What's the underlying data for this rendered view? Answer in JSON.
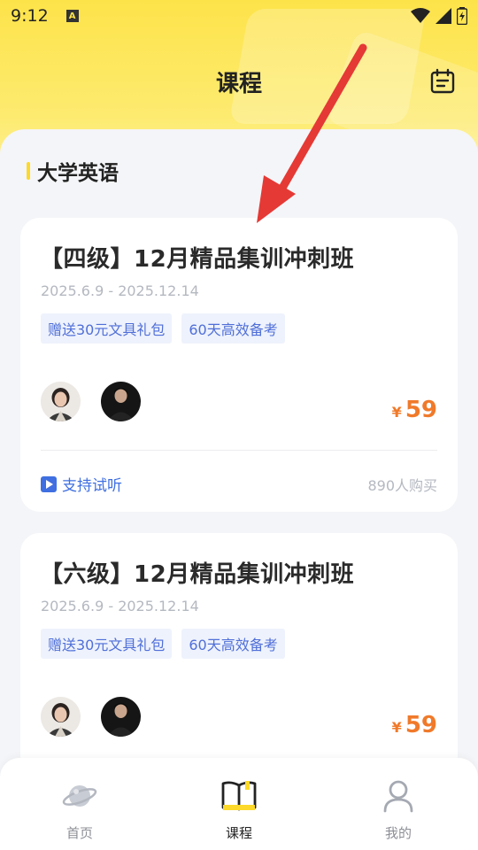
{
  "status_bar": {
    "time": "9:12",
    "notification_icon": "A"
  },
  "header": {
    "title": "课程",
    "calendar_icon": "calendar-icon"
  },
  "section": {
    "title": "大学英语"
  },
  "courses": [
    {
      "title": "【四级】12月精品集训冲刺班",
      "date": "2025.6.9 - 2025.12.14",
      "tags": [
        "赠送30元文具礼包",
        "60天高效备考"
      ],
      "currency": "¥",
      "price": "59",
      "trial_label": "支持试听",
      "buyers": "890人购买"
    },
    {
      "title": "【六级】12月精品集训冲刺班",
      "date": "2025.6.9 - 2025.12.14",
      "tags": [
        "赠送30元文具礼包",
        "60天高效备考"
      ],
      "currency": "¥",
      "price": "59"
    }
  ],
  "tabbar": {
    "items": [
      {
        "label": "首页",
        "icon": "planet-icon",
        "active": false
      },
      {
        "label": "课程",
        "icon": "book-icon",
        "active": true
      },
      {
        "label": "我的",
        "icon": "user-icon",
        "active": false
      }
    ]
  },
  "colors": {
    "header_yellow": "#fde34a",
    "accent_orange": "#f07a2a",
    "link_blue": "#3f6fe0",
    "annotation_red": "#e53935"
  }
}
